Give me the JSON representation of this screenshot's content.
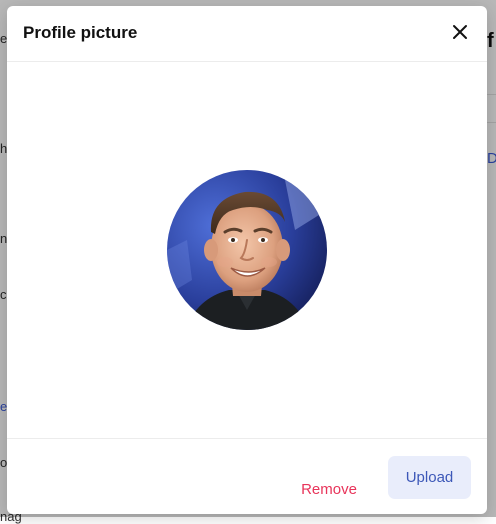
{
  "modal": {
    "title": "Profile picture",
    "remove_label": "Remove",
    "upload_label": "Upload"
  },
  "background": {
    "fragments": [
      "e",
      "ha",
      "nd",
      "c",
      "e",
      "on",
      "nag",
      "f",
      "D"
    ]
  },
  "colors": {
    "remove": "#e8345a",
    "upload_bg": "#e9edfb",
    "upload_text": "#3d58b8"
  },
  "icons": {
    "close": "close-icon",
    "avatar": "profile-avatar"
  }
}
